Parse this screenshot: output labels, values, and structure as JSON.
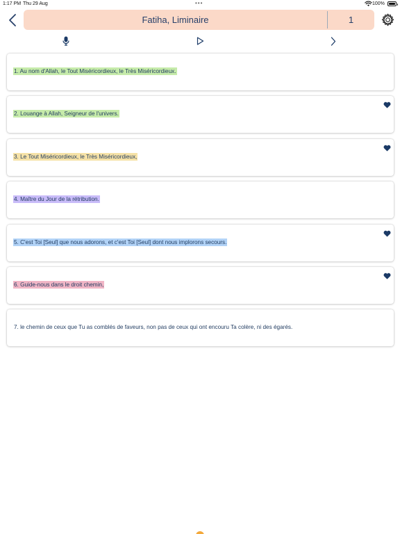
{
  "status_bar": {
    "time": "1:17 PM",
    "date": "Thu 29 Aug",
    "dots": "•••",
    "battery": "100%"
  },
  "header": {
    "title": "Fatiha, Liminaire",
    "verse_number": "1",
    "back_icon": "chevron-left-icon",
    "settings_icon": "gear-icon"
  },
  "toolbar": {
    "mic_icon": "microphone-icon",
    "play_icon": "play-icon",
    "next_icon": "chevron-right-icon"
  },
  "colors": {
    "title_bar": "#fbd9c8",
    "text": "#1f3a5f",
    "heart": "#1b3a66",
    "green": "#c6ebaa",
    "yellow": "#f6e2a7",
    "purple": "#c9bcf9",
    "blue": "#b2d3f7",
    "pink": "#f1b6c6"
  },
  "verses": [
    {
      "text": "1. Au nom d'Allah, le Tout Miséricordieux, le Très Miséricordieux.",
      "highlight": "#c6ebaa",
      "favorite": false
    },
    {
      "text": "2. Louange à Allah, Seigneur de l'univers.",
      "highlight": "#c6ebaa",
      "favorite": true
    },
    {
      "text": "3. Le Tout Miséricordieux, le Très Miséricordieux,",
      "highlight": "#f6e2a7",
      "favorite": true
    },
    {
      "text": "4. Maître du Jour de la rétribution.",
      "highlight": "#c9bcf9",
      "favorite": false
    },
    {
      "text": "5. C'est Toi [Seul] que nous adorons, et c'est Toi [Seul] dont nous implorons secours.",
      "highlight": "#b2d3f7",
      "favorite": true
    },
    {
      "text": "6. Guide-nous dans le droit chemin,",
      "highlight": "#f1b6c6",
      "favorite": true
    },
    {
      "text": "7. le chemin de ceux que Tu as comblés de faveurs, non pas de ceux qui ont encouru Ta colère, ni des égarés.",
      "highlight": "",
      "favorite": false
    }
  ]
}
